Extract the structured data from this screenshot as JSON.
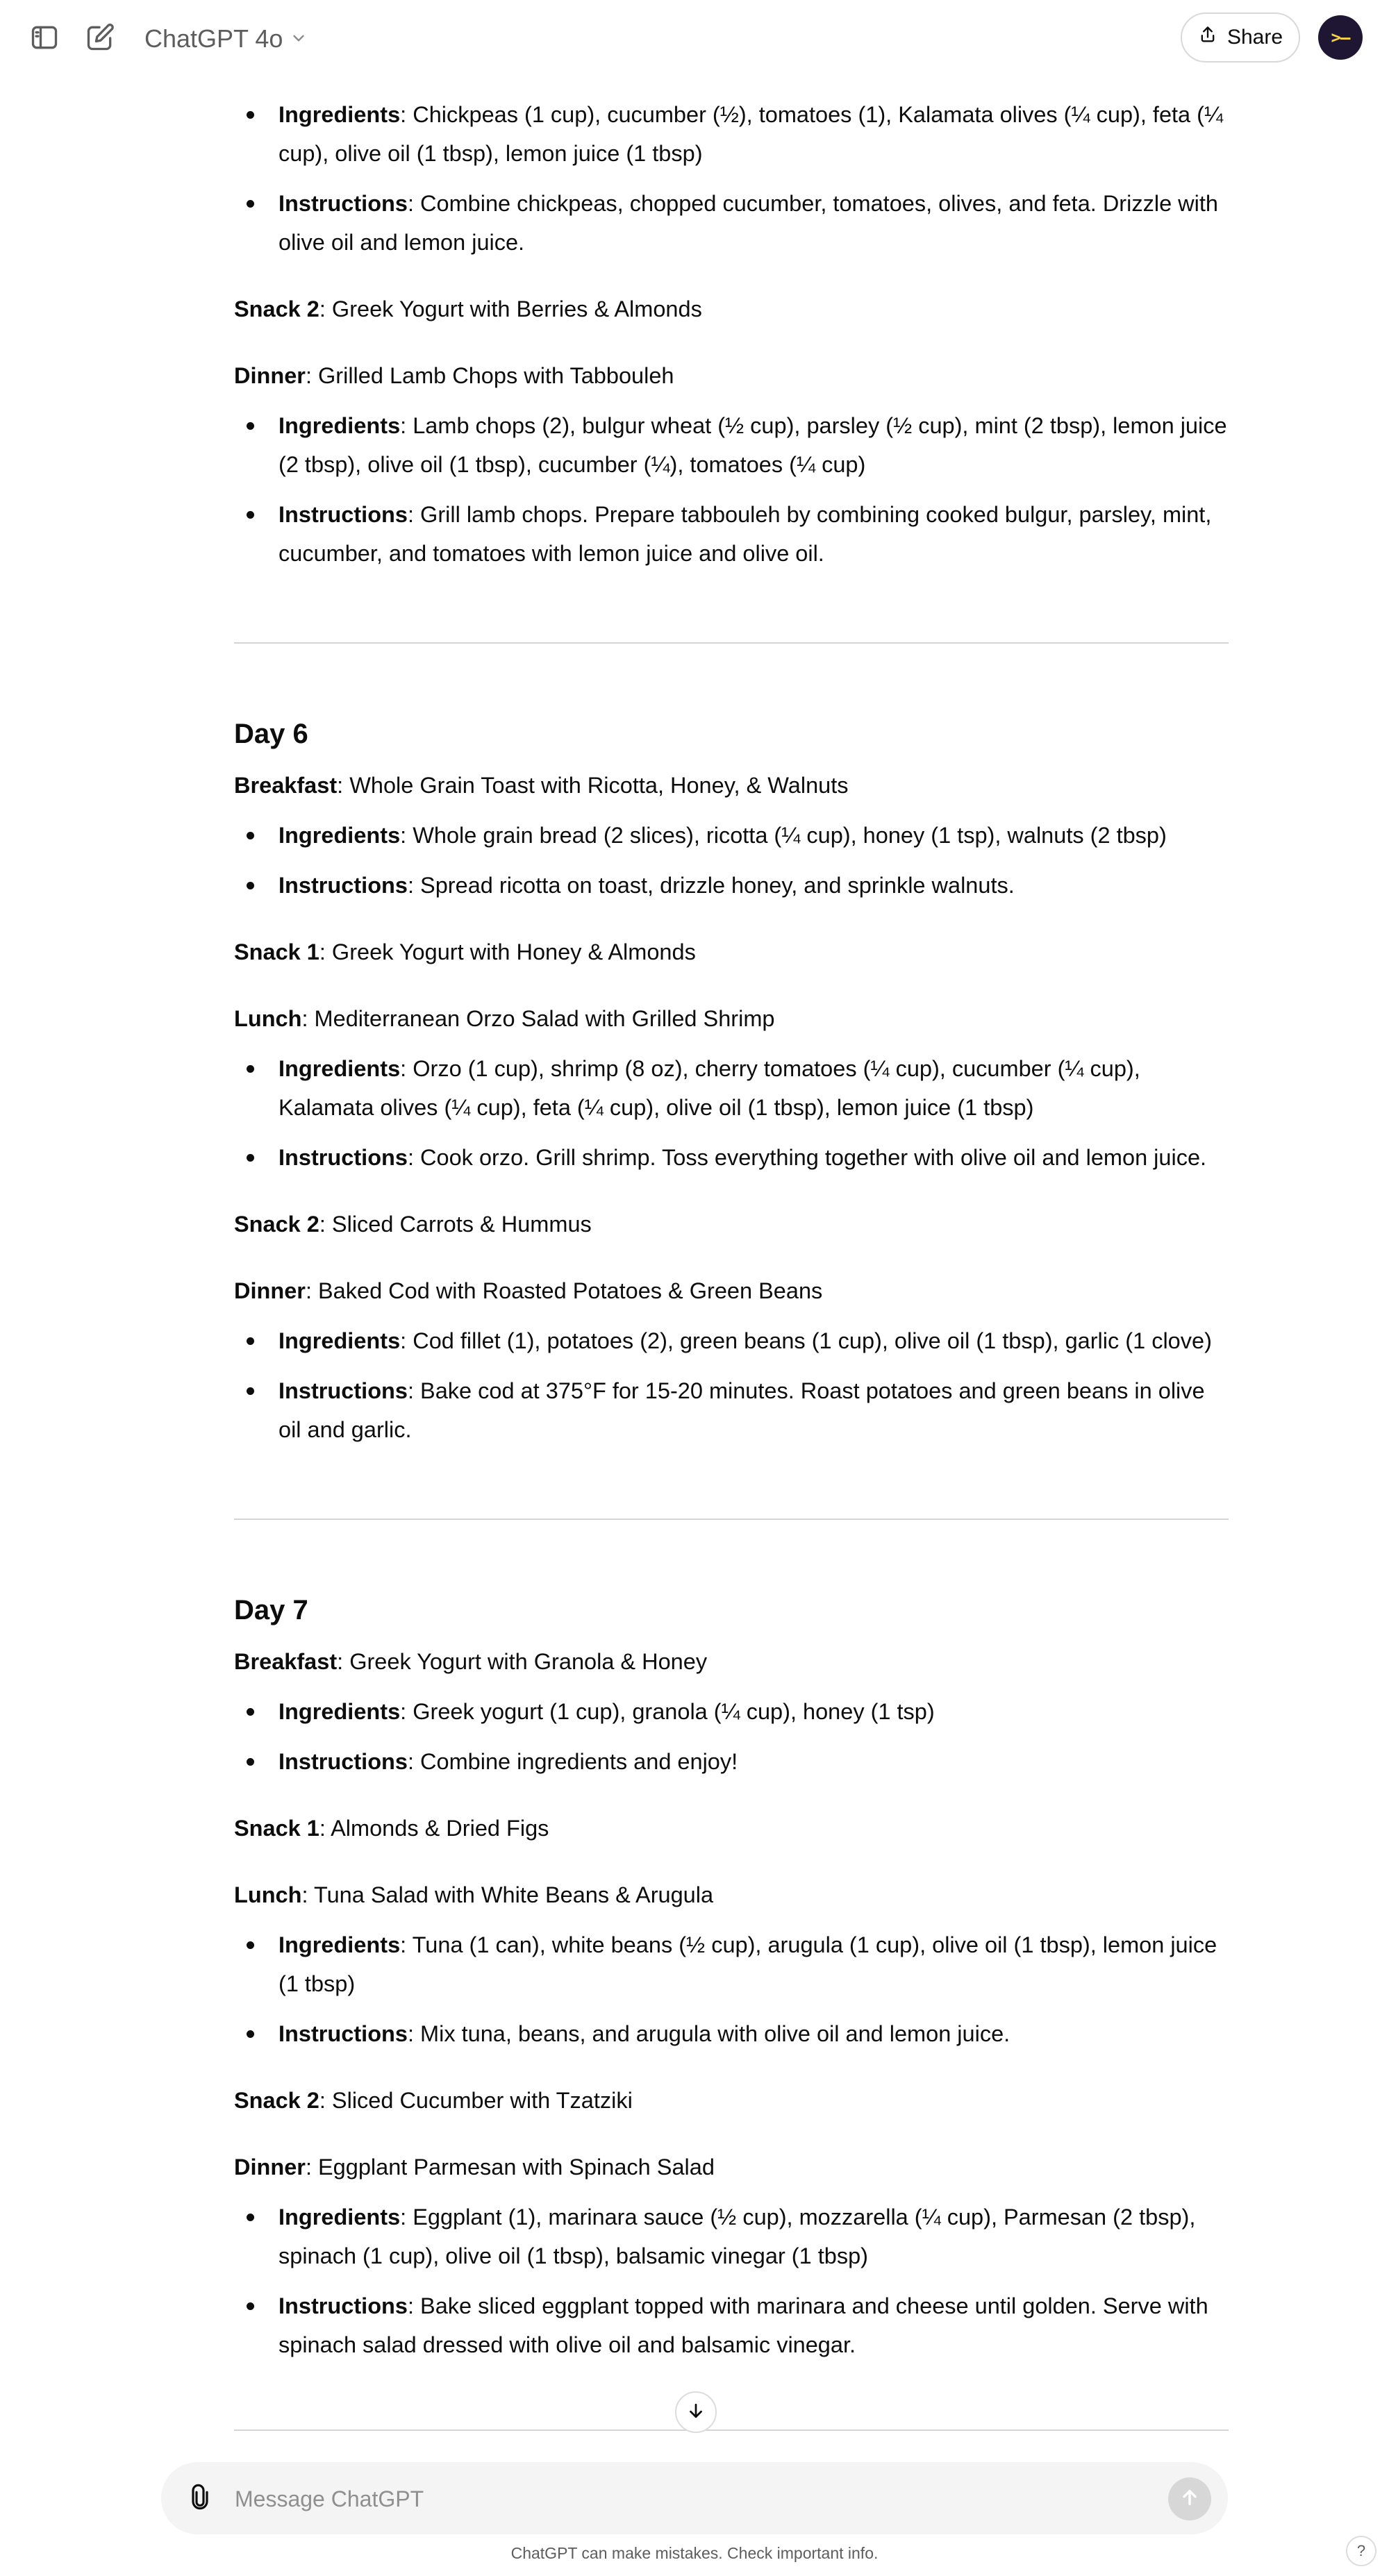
{
  "header": {
    "model_name": "ChatGPT 4o",
    "share_label": "Share",
    "avatar_text": ">–"
  },
  "day5_tail": {
    "lunch_ingredients_label": "Ingredients",
    "lunch_ingredients": ": Chickpeas (1 cup), cucumber (½), tomatoes (1), Kalamata olives (¼ cup), feta (¼ cup), olive oil (1 tbsp), lemon juice (1 tbsp)",
    "lunch_instructions_label": "Instructions",
    "lunch_instructions": ": Combine chickpeas, chopped cucumber, tomatoes, olives, and feta. Drizzle with olive oil and lemon juice.",
    "snack2_label": "Snack 2",
    "snack2": ": Greek Yogurt with Berries & Almonds",
    "dinner_label": "Dinner",
    "dinner": ": Grilled Lamb Chops with Tabbouleh",
    "dinner_ingredients_label": "Ingredients",
    "dinner_ingredients": ": Lamb chops (2), bulgur wheat (½ cup), parsley (½ cup), mint (2 tbsp), lemon juice (2 tbsp), olive oil (1 tbsp), cucumber (¼), tomatoes (¼ cup)",
    "dinner_instructions_label": "Instructions",
    "dinner_instructions": ": Grill lamb chops. Prepare tabbouleh by combining cooked bulgur, parsley, mint, cucumber, and tomatoes with lemon juice and olive oil."
  },
  "day6": {
    "title": "Day 6",
    "breakfast_label": "Breakfast",
    "breakfast": ": Whole Grain Toast with Ricotta, Honey, & Walnuts",
    "breakfast_ingredients_label": "Ingredients",
    "breakfast_ingredients": ": Whole grain bread (2 slices), ricotta (¼ cup), honey (1 tsp), walnuts (2 tbsp)",
    "breakfast_instructions_label": "Instructions",
    "breakfast_instructions": ": Spread ricotta on toast, drizzle honey, and sprinkle walnuts.",
    "snack1_label": "Snack 1",
    "snack1": ": Greek Yogurt with Honey & Almonds",
    "lunch_label": "Lunch",
    "lunch": ": Mediterranean Orzo Salad with Grilled Shrimp",
    "lunch_ingredients_label": "Ingredients",
    "lunch_ingredients": ": Orzo (1 cup), shrimp (8 oz), cherry tomatoes (¼ cup), cucumber (¼ cup), Kalamata olives (¼ cup), feta (¼ cup), olive oil (1 tbsp), lemon juice (1 tbsp)",
    "lunch_instructions_label": "Instructions",
    "lunch_instructions": ": Cook orzo. Grill shrimp. Toss everything together with olive oil and lemon juice.",
    "snack2_label": "Snack 2",
    "snack2": ": Sliced Carrots & Hummus",
    "dinner_label": "Dinner",
    "dinner": ": Baked Cod with Roasted Potatoes & Green Beans",
    "dinner_ingredients_label": "Ingredients",
    "dinner_ingredients": ": Cod fillet (1), potatoes (2), green beans (1 cup), olive oil (1 tbsp), garlic (1 clove)",
    "dinner_instructions_label": "Instructions",
    "dinner_instructions": ": Bake cod at 375°F for 15-20 minutes. Roast potatoes and green beans in olive oil and garlic."
  },
  "day7": {
    "title": "Day 7",
    "breakfast_label": "Breakfast",
    "breakfast": ": Greek Yogurt with Granola & Honey",
    "breakfast_ingredients_label": "Ingredients",
    "breakfast_ingredients": ": Greek yogurt (1 cup), granola (¼ cup), honey (1 tsp)",
    "breakfast_instructions_label": "Instructions",
    "breakfast_instructions": ": Combine ingredients and enjoy!",
    "snack1_label": "Snack 1",
    "snack1": ": Almonds & Dried Figs",
    "lunch_label": "Lunch",
    "lunch": ": Tuna Salad with White Beans & Arugula",
    "lunch_ingredients_label": "Ingredients",
    "lunch_ingredients": ": Tuna (1 can), white beans (½ cup), arugula (1 cup), olive oil (1 tbsp), lemon juice (1 tbsp)",
    "lunch_instructions_label": "Instructions",
    "lunch_instructions": ": Mix tuna, beans, and arugula with olive oil and lemon juice.",
    "snack2_label": "Snack 2",
    "snack2": ": Sliced Cucumber with Tzatziki",
    "dinner_label": "Dinner",
    "dinner": ": Eggplant Parmesan with Spinach Salad",
    "dinner_ingredients_label": "Ingredients",
    "dinner_ingredients": ": Eggplant (1), marinara sauce (½ cup), mozzarella (¼ cup), Parmesan (2 tbsp), spinach (1 cup), olive oil (1 tbsp), balsamic vinegar (1 tbsp)",
    "dinner_instructions_label": "Instructions",
    "dinner_instructions": ": Bake sliced eggplant topped with marinara and cheese until golden. Serve with spinach salad dressed with olive oil and balsamic vinegar."
  },
  "composer": {
    "placeholder": "Message ChatGPT"
  },
  "footer": {
    "disclaimer": "ChatGPT can make mistakes. Check important info.",
    "help_label": "?"
  },
  "icons": {
    "sidebar_toggle": "sidebar-toggle-icon",
    "new_chat": "new-chat-icon",
    "model_dropdown": "chevron-down-icon",
    "share": "share-icon",
    "scroll_down": "arrow-down-icon",
    "attach": "paperclip-icon",
    "send": "arrow-up-icon"
  }
}
